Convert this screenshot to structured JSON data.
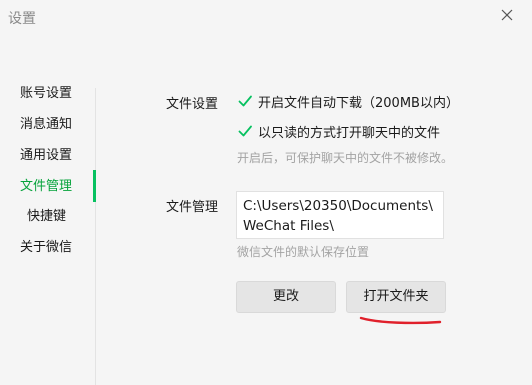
{
  "window": {
    "title": "设置",
    "close_icon": "close-icon"
  },
  "sidebar": {
    "items": [
      {
        "label": "账号设置",
        "active": false
      },
      {
        "label": "消息通知",
        "active": false
      },
      {
        "label": "通用设置",
        "active": false
      },
      {
        "label": "文件管理",
        "active": true
      },
      {
        "label": "快捷键",
        "active": false
      },
      {
        "label": "关于微信",
        "active": false
      }
    ]
  },
  "file_settings": {
    "label": "文件设置",
    "auto_download": {
      "label": "开启文件自动下载（200MB以内）",
      "checked": true
    },
    "read_only": {
      "label": "以只读的方式打开聊天中的文件",
      "checked": true
    },
    "hint": "开启后，可保护聊天中的文件不被修改。"
  },
  "file_management": {
    "label": "文件管理",
    "path_line1": "C:\\Users\\20350\\Documents\\",
    "path_line2": "WeChat Files\\",
    "hint": "微信文件的默认保存位置",
    "change_button": "更改",
    "open_folder_button": "打开文件夹"
  },
  "colors": {
    "accent": "#07c160",
    "annotation": "#e0202b"
  }
}
